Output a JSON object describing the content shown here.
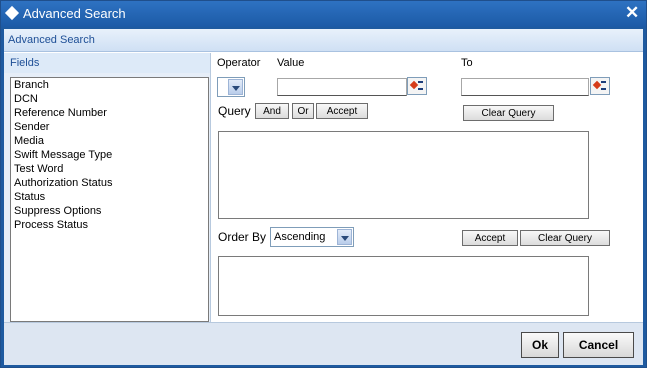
{
  "window": {
    "title": "Advanced Search",
    "close_glyph": "✕"
  },
  "subheader": {
    "title": "Advanced Search"
  },
  "fields": {
    "heading": "Fields",
    "items": [
      "Branch",
      "DCN",
      "Reference Number",
      "Sender",
      "Media",
      "Swift Message Type",
      "Test Word",
      "Authorization Status",
      "Status",
      "Suppress Options",
      "Process Status"
    ]
  },
  "criteria": {
    "operator_label": "Operator",
    "value_label": "Value",
    "to_label": "To",
    "operator_value": "",
    "value_input": "",
    "to_input": ""
  },
  "query": {
    "label": "Query",
    "and_button": "And",
    "or_button": "Or",
    "accept_button": "Accept",
    "clear_button": "Clear Query"
  },
  "order": {
    "label": "Order By",
    "selected": "Ascending",
    "accept_button": "Accept",
    "clear_button": "Clear Query"
  },
  "footer": {
    "ok_button": "Ok",
    "cancel_button": "Cancel"
  },
  "icons": {
    "lov": "list-of-values-icon",
    "close": "close-icon",
    "title": "diamond-icon"
  }
}
